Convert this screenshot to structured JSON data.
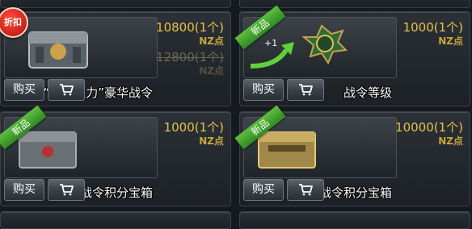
{
  "items": [
    {
      "badge": "折扣",
      "name": "“森林之力”豪华战令",
      "price": "10800(1个)",
      "currency": "NZ点",
      "old_price": "12800(1个)",
      "old_currency": "NZ点",
      "buy_label": "购买"
    },
    {
      "badge": "新品",
      "name": "战令等级",
      "price": "1000(1个)",
      "currency": "NZ点",
      "buy_label": "购买",
      "art_text": "+1"
    },
    {
      "badge": "新品",
      "name": "战令积分宝箱",
      "price": "1000(1个)",
      "currency": "NZ点",
      "buy_label": "购买"
    },
    {
      "badge": "新品",
      "name": "高级战令积分宝箱",
      "price": "10000(1个)",
      "currency": "NZ点",
      "buy_label": "购买"
    }
  ],
  "colors": {
    "price": "#e8c24a",
    "ribbon": "#3fa02a",
    "sale_badge": "#d4241a"
  },
  "icons": [
    "cart-icon"
  ]
}
